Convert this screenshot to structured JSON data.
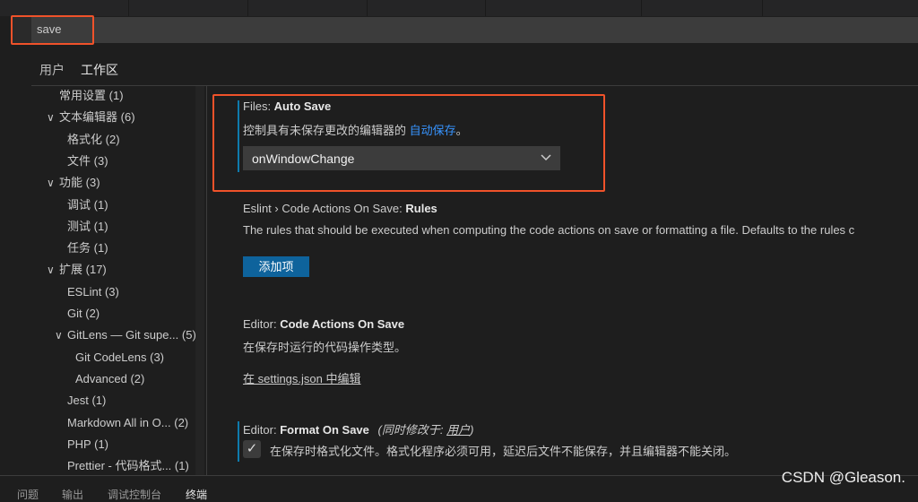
{
  "search": {
    "value": "save"
  },
  "scope_tabs": [
    {
      "label": "用户"
    },
    {
      "label": "工作区",
      "active": true
    }
  ],
  "tree": [
    {
      "label": "常用设置",
      "count": "(1)",
      "level": 0,
      "chevron": false
    },
    {
      "label": "文本编辑器",
      "count": "(6)",
      "level": 0,
      "chevron": true
    },
    {
      "label": "格式化",
      "count": "(2)",
      "level": 1,
      "chevron": false
    },
    {
      "label": "文件",
      "count": "(3)",
      "level": 1,
      "chevron": false
    },
    {
      "label": "功能",
      "count": "(3)",
      "level": 0,
      "chevron": true
    },
    {
      "label": "调试",
      "count": "(1)",
      "level": 1,
      "chevron": false
    },
    {
      "label": "测试",
      "count": "(1)",
      "level": 1,
      "chevron": false
    },
    {
      "label": "任务",
      "count": "(1)",
      "level": 1,
      "chevron": false
    },
    {
      "label": "扩展",
      "count": "(17)",
      "level": 0,
      "chevron": true
    },
    {
      "label": "ESLint",
      "count": "(3)",
      "level": 1,
      "chevron": false
    },
    {
      "label": "Git",
      "count": "(2)",
      "level": 1,
      "chevron": false
    },
    {
      "label": "GitLens — Git supe...",
      "count": "(5)",
      "level": 1,
      "chevron": true
    },
    {
      "label": "Git CodeLens",
      "count": "(3)",
      "level": 2,
      "chevron": false
    },
    {
      "label": "Advanced",
      "count": "(2)",
      "level": 2,
      "chevron": false
    },
    {
      "label": "Jest",
      "count": "(1)",
      "level": 1,
      "chevron": false
    },
    {
      "label": "Markdown All in O...",
      "count": "(2)",
      "level": 1,
      "chevron": false
    },
    {
      "label": "PHP",
      "count": "(1)",
      "level": 1,
      "chevron": false
    },
    {
      "label": "Prettier - 代码格式...",
      "count": "(1)",
      "level": 1,
      "chevron": false
    }
  ],
  "settings": {
    "auto_save": {
      "category": "Files: ",
      "name": "Auto Save",
      "desc": "控制具有未保存更改的编辑器的 ",
      "link": "自动保存",
      "desc_end": "。",
      "value": "onWindowChange"
    },
    "eslint": {
      "category": "Eslint › Code Actions On Save: ",
      "name": "Rules",
      "desc": "The rules that should be executed when computing the code actions on save or formatting a file. Defaults to the rules c",
      "button": "添加项"
    },
    "code_actions": {
      "category": "Editor: ",
      "name": "Code Actions On Save",
      "desc": "在保存时运行的代码操作类型。",
      "link": "在 settings.json 中编辑"
    },
    "format_on_save": {
      "category": "Editor: ",
      "name": "Format On Save",
      "modified": "(同时修改于: ",
      "modified_link": "用户",
      "modified_end": ")",
      "desc": "在保存时格式化文件。格式化程序必须可用，延迟后文件不能保存，并且编辑器不能关闭。",
      "checked": true
    }
  },
  "panel_tabs": [
    "问题",
    "输出",
    "调试控制台",
    "终端"
  ],
  "watermark": "CSDN @Gleason.",
  "colors": {
    "highlight": "#f0522a",
    "link": "#3794ff",
    "button": "#0e639c",
    "modified": "#0e7bad"
  }
}
